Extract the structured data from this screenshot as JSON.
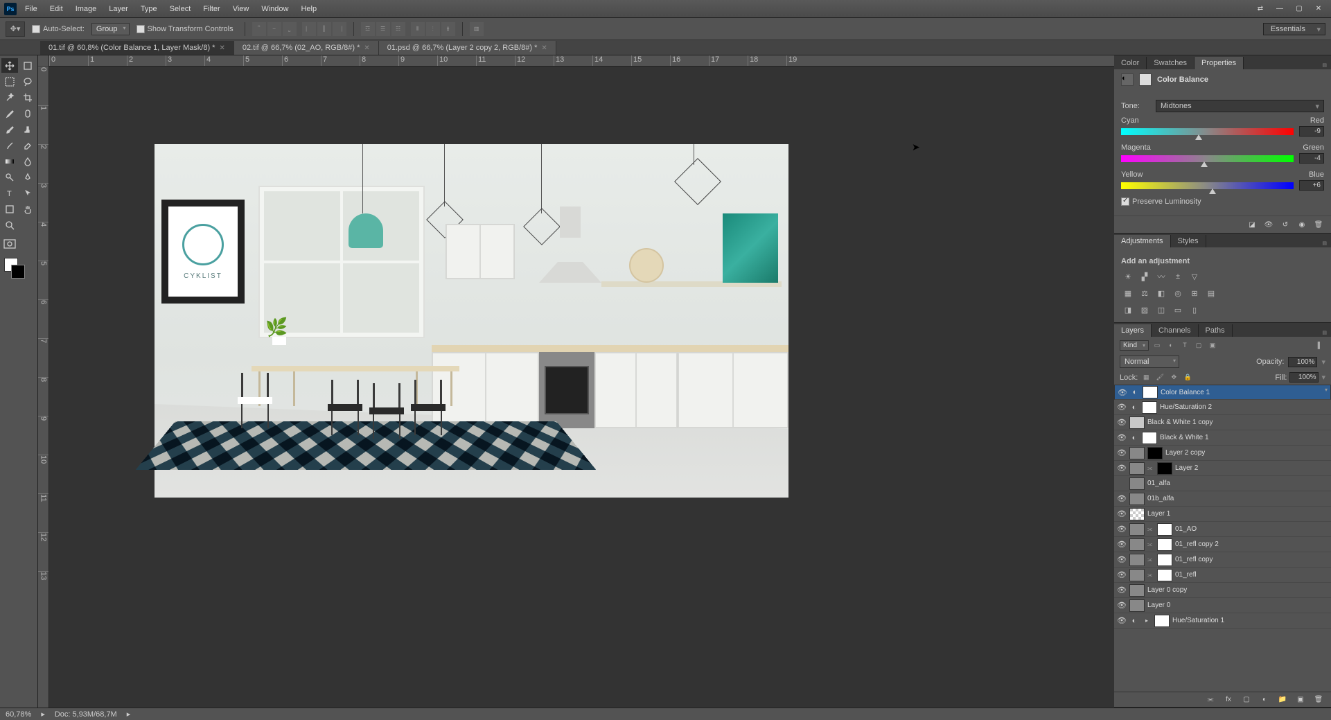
{
  "app": {
    "name": "Ps"
  },
  "menu": [
    "File",
    "Edit",
    "Image",
    "Layer",
    "Type",
    "Select",
    "Filter",
    "View",
    "Window",
    "Help"
  ],
  "options": {
    "autoselect": "Auto-Select:",
    "group": "Group",
    "transform": "Show Transform Controls"
  },
  "essentials": "Essentials",
  "tabs": [
    {
      "label": "01.tif @ 60,8% (Color Balance 1, Layer Mask/8) *",
      "active": true
    },
    {
      "label": "02.tif @ 66,7% (02_AO, RGB/8#) *",
      "active": false
    },
    {
      "label": "01.psd @ 66,7% (Layer 2 copy 2, RGB/8#) *",
      "active": false
    }
  ],
  "rulerH": [
    "0",
    "1",
    "2",
    "3",
    "4",
    "5",
    "6",
    "7",
    "8",
    "9",
    "10",
    "11",
    "12",
    "13",
    "14",
    "15",
    "16",
    "17",
    "18",
    "19"
  ],
  "rulerV": [
    "0",
    "1",
    "2",
    "3",
    "4",
    "5",
    "6",
    "7",
    "8",
    "9",
    "10",
    "11",
    "12",
    "13"
  ],
  "panels": {
    "color": [
      "Color",
      "Swatches",
      "Properties"
    ],
    "adj": [
      "Adjustments",
      "Styles"
    ],
    "layers": [
      "Layers",
      "Channels",
      "Paths"
    ]
  },
  "properties": {
    "title": "Color Balance",
    "toneLabel": "Tone:",
    "tone": "Midtones",
    "sliders": [
      {
        "left": "Cyan",
        "right": "Red",
        "value": "-9",
        "pos": 45
      },
      {
        "left": "Magenta",
        "right": "Green",
        "value": "-4",
        "pos": 48
      },
      {
        "left": "Yellow",
        "right": "Blue",
        "value": "+6",
        "pos": 53
      }
    ],
    "preserve": "Preserve Luminosity"
  },
  "adjustments": {
    "title": "Add an adjustment"
  },
  "layersPanel": {
    "kind": "Kind",
    "blend": "Normal",
    "opacityLabel": "Opacity:",
    "opacity": "100%",
    "lockLabel": "Lock:",
    "fillLabel": "Fill:",
    "fill": "100%",
    "items": [
      {
        "name": "Color Balance 1",
        "eye": true,
        "adj": true,
        "mask": "white",
        "selected": true
      },
      {
        "name": "Hue/Saturation 2",
        "eye": true,
        "adj": true,
        "mask": "white"
      },
      {
        "name": "Black & White 1 copy",
        "eye": true,
        "adj": false,
        "solid": true
      },
      {
        "name": "Black & White 1",
        "eye": true,
        "adj": true,
        "mask": "white"
      },
      {
        "name": "Layer 2 copy",
        "eye": true,
        "thumb": true,
        "mask": "black"
      },
      {
        "name": "Layer 2",
        "eye": true,
        "thumb": true,
        "mask": "black",
        "link": true
      },
      {
        "name": "01_alfa",
        "eye": false,
        "thumb": true
      },
      {
        "name": "01b_alfa",
        "eye": true,
        "thumb": true
      },
      {
        "name": "Layer 1",
        "eye": true,
        "thumb": true,
        "checker": true
      },
      {
        "name": "01_AO",
        "eye": true,
        "thumb": true,
        "mask": "white",
        "link": true
      },
      {
        "name": "01_refl copy 2",
        "eye": true,
        "thumb": true,
        "mask": "white",
        "link": true
      },
      {
        "name": "01_refl copy",
        "eye": true,
        "thumb": true,
        "mask": "white",
        "link": true
      },
      {
        "name": "01_refl",
        "eye": true,
        "thumb": true,
        "mask": "white",
        "link": true
      },
      {
        "name": "Layer 0 copy",
        "eye": true,
        "thumb": true
      },
      {
        "name": "Layer 0",
        "eye": true,
        "thumb": true
      },
      {
        "name": "Hue/Saturation 1",
        "eye": true,
        "adj": true,
        "mask": "white",
        "arrow": true
      }
    ]
  },
  "status": {
    "zoom": "60,78%",
    "doc": "Doc: 5,93M/68,7M"
  },
  "scene": {
    "poster": "CYKLIST"
  }
}
